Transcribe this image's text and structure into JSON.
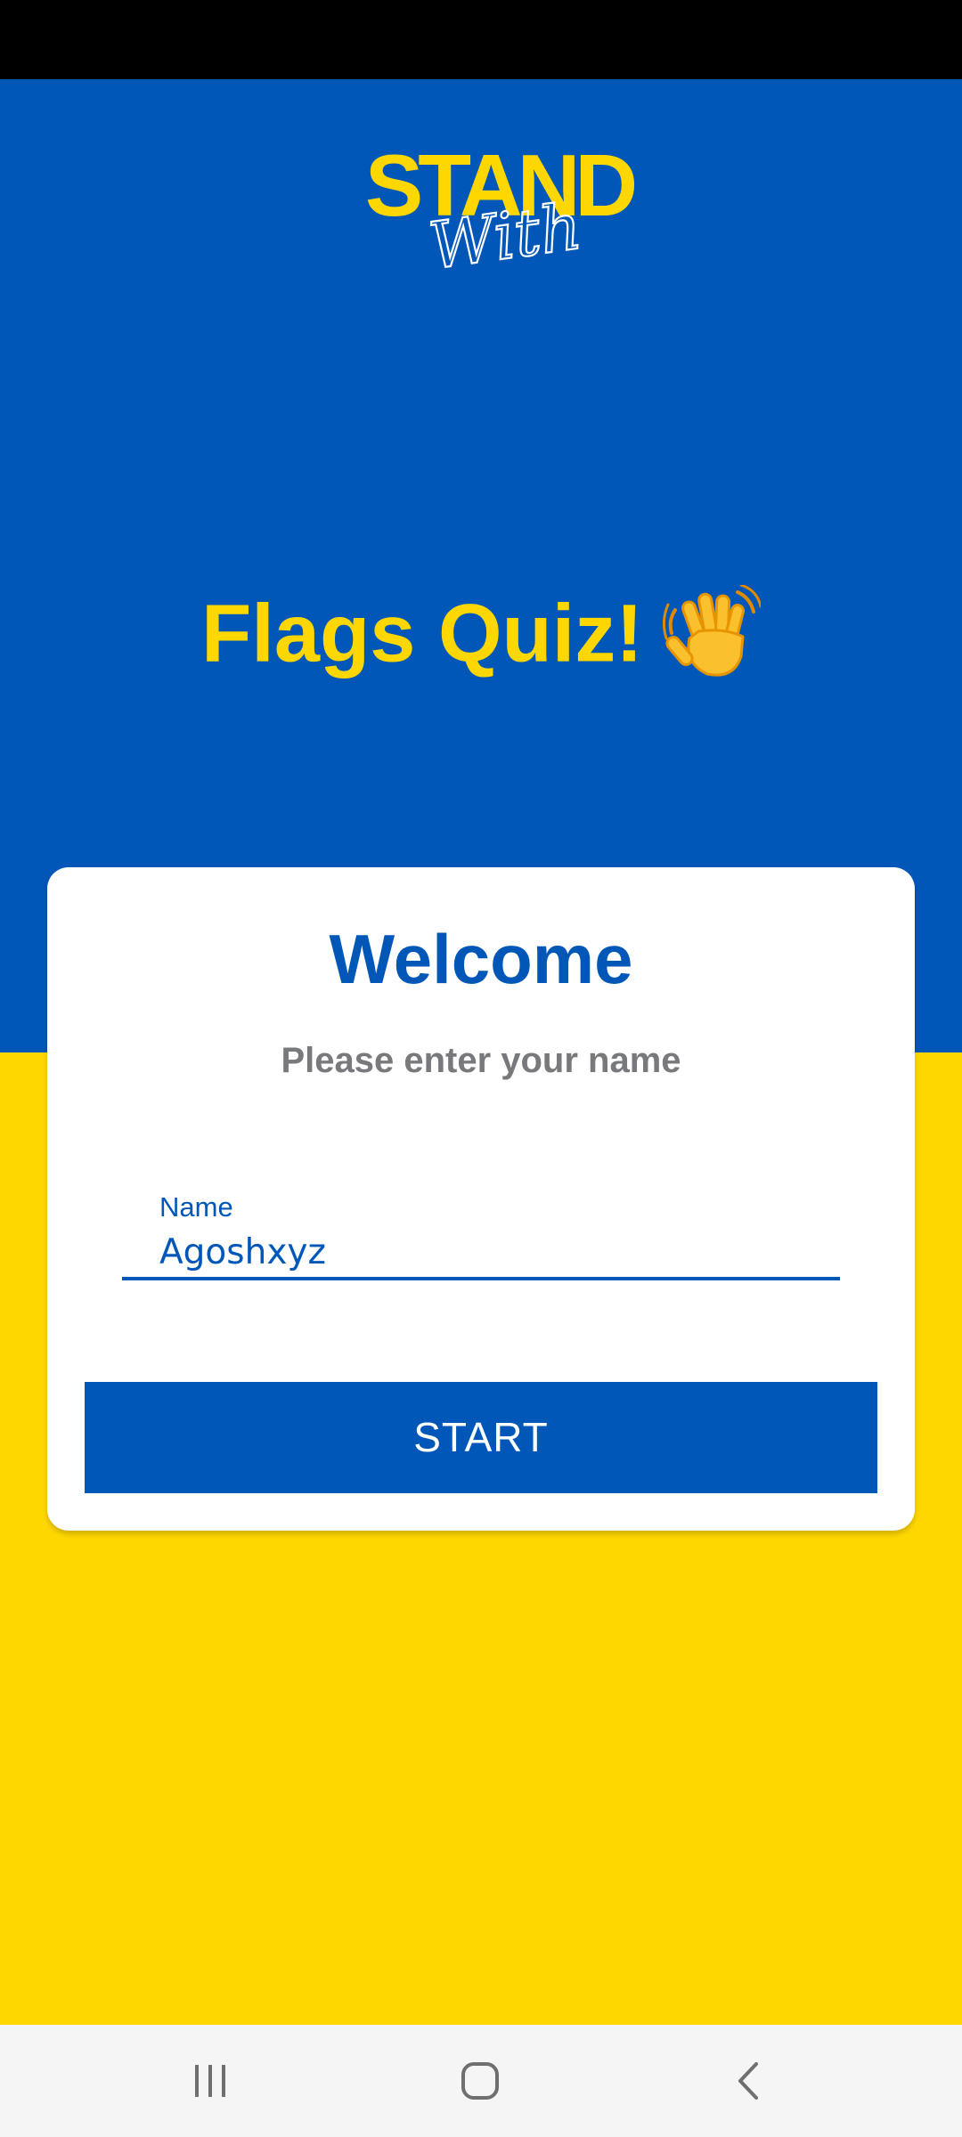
{
  "logo": {
    "line1": "STAND",
    "line2": "With"
  },
  "hero": {
    "title": "Flags Quiz!",
    "emoji_icon": "waving-hand-icon"
  },
  "card": {
    "heading": "Welcome",
    "subtitle": "Please enter your name",
    "name_field": {
      "label": "Name",
      "value": "Agoshxyz"
    },
    "start_label": "START"
  },
  "navigation": {
    "recent_icon": "recent-apps-icon",
    "home_icon": "home-icon",
    "back_icon": "back-icon"
  },
  "colors": {
    "flag_blue": "#0057B8",
    "flag_yellow": "#FFD700",
    "subtitle_gray": "#77797d",
    "status_bar": "#000000",
    "nav_bar": "#f5f5f5"
  }
}
